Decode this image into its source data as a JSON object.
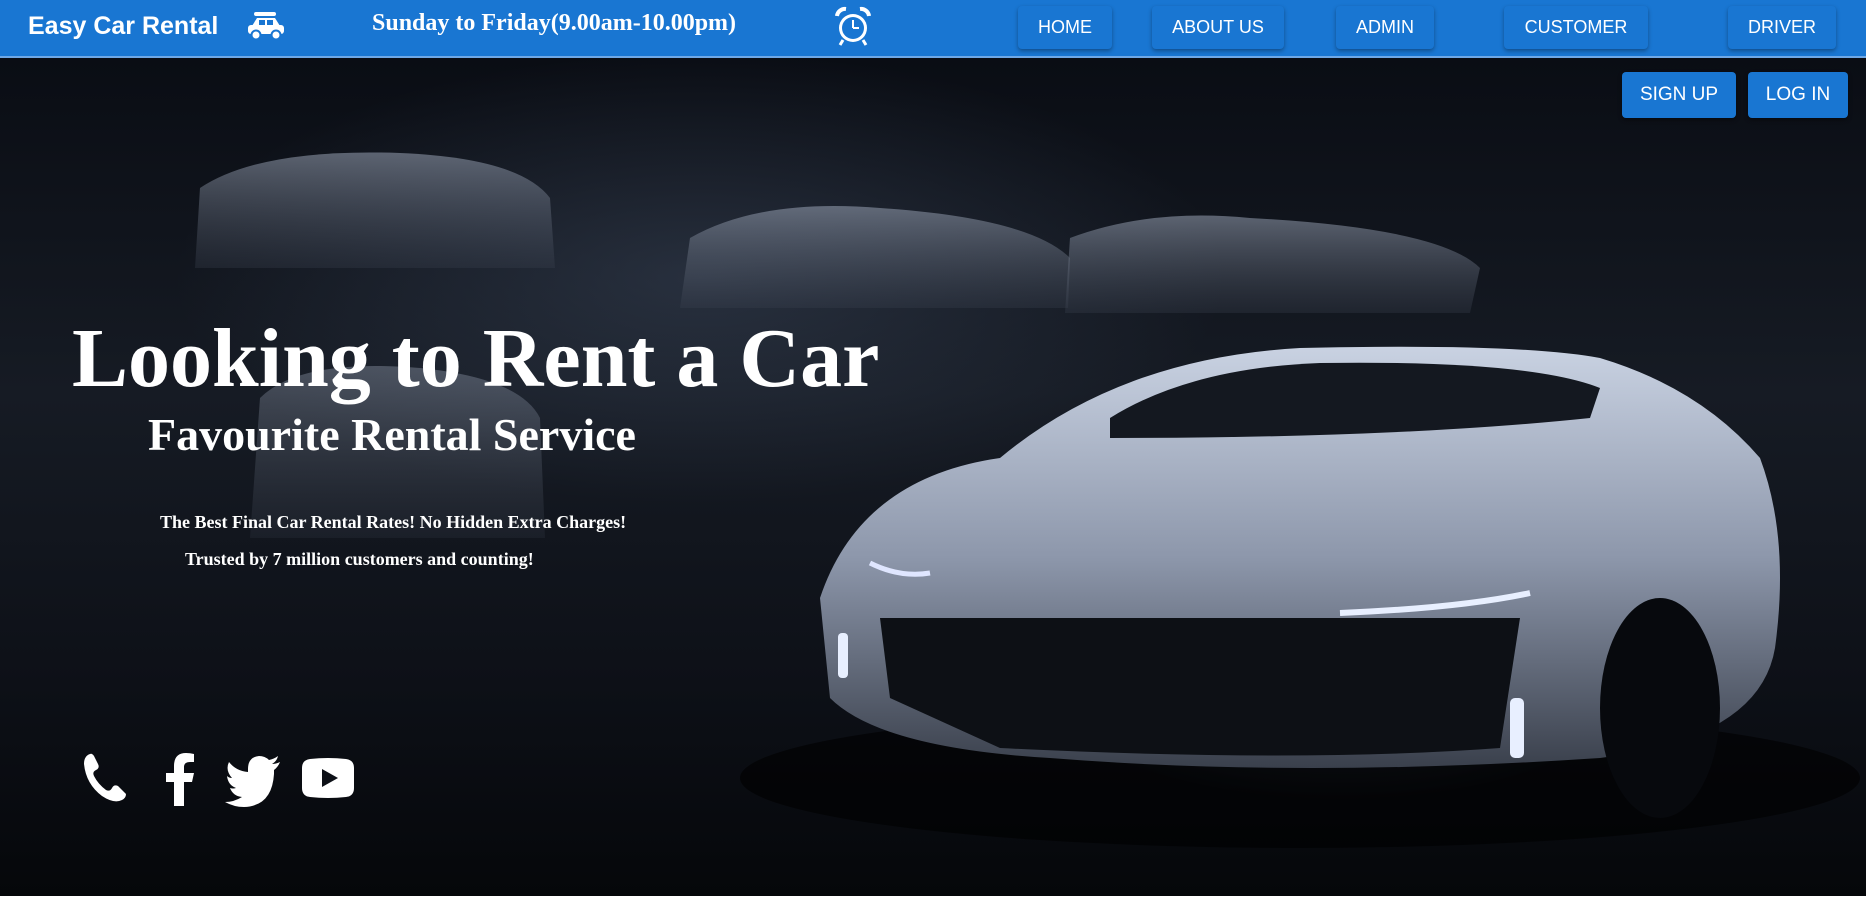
{
  "header": {
    "brand": "Easy Car Rental",
    "hours": "Sunday to Friday(9.00am-10.00pm)",
    "nav": [
      "HOME",
      "ABOUT US",
      "ADMIN",
      "CUSTOMER",
      "DRIVER"
    ]
  },
  "auth": {
    "signup": "SIGN UP",
    "login": "LOG IN"
  },
  "hero": {
    "headline": "Looking to Rent a Car",
    "subheadline": "Favourite Rental Service",
    "tagline1": "The Best Final Car Rental Rates! No Hidden Extra Charges!",
    "tagline2": "Trusted by 7 million customers and counting!"
  },
  "social": [
    "phone-icon",
    "facebook-icon",
    "twitter-icon",
    "youtube-icon"
  ],
  "colors": {
    "primary": "#1976d2",
    "text": "#ffffff",
    "background": "#0d1017"
  }
}
